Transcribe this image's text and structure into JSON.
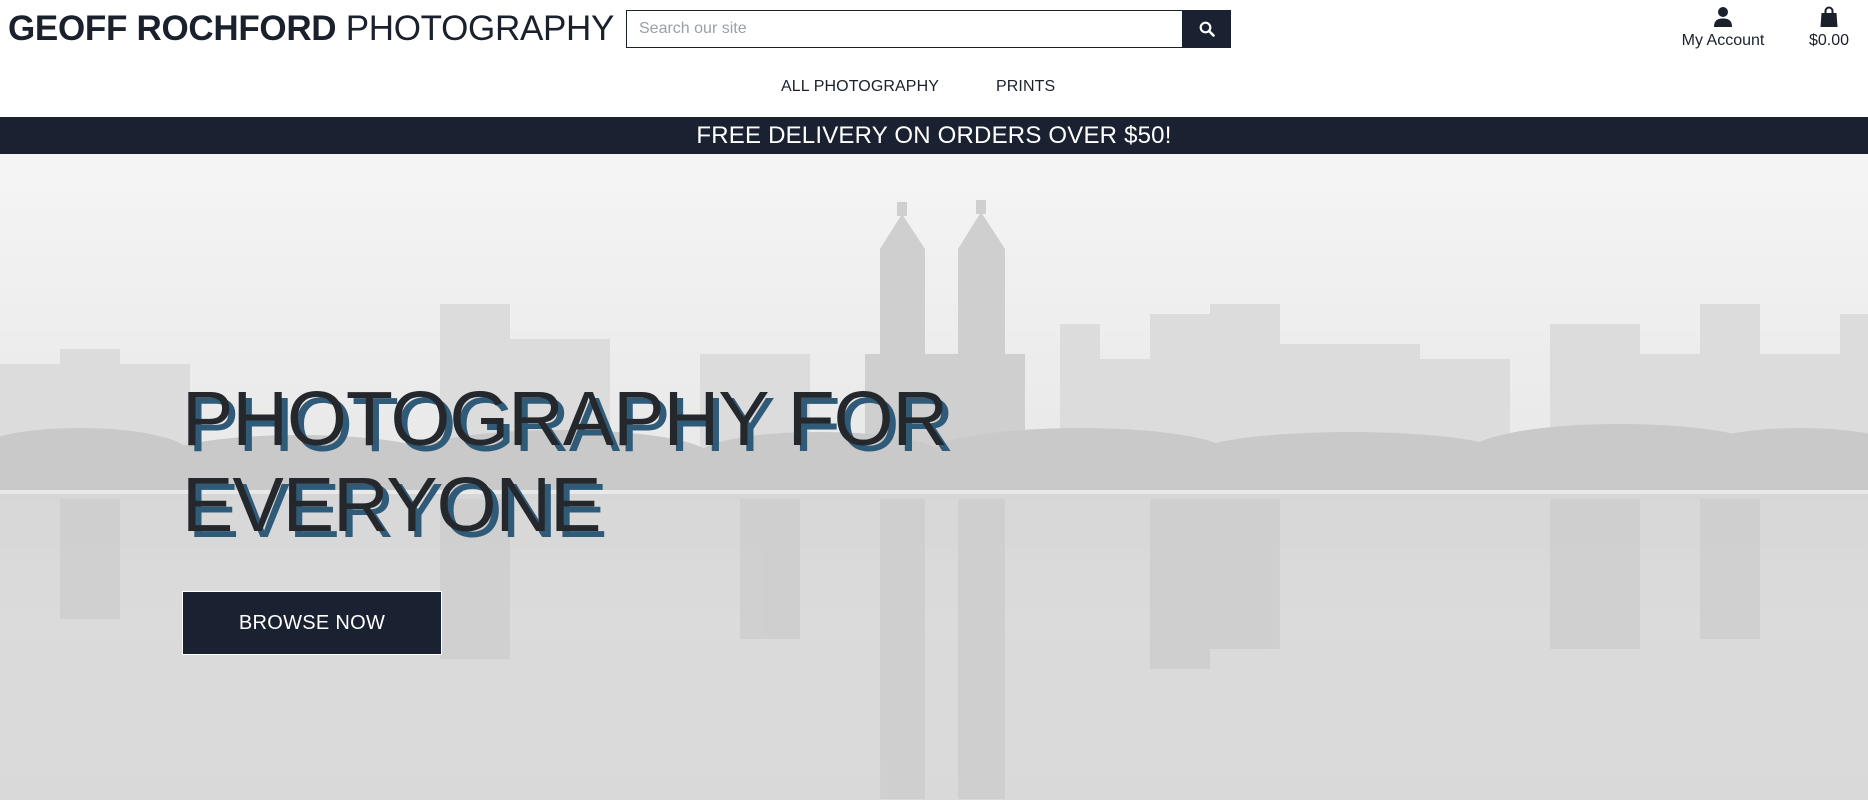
{
  "brand": {
    "bold": "GEOFF ROCHFORD",
    "light": "PHOTOGRAPHY"
  },
  "search": {
    "placeholder": "Search our site",
    "icon": "search-icon"
  },
  "account": {
    "label": "My Account",
    "icon": "user-icon"
  },
  "bag": {
    "total": "$0.00",
    "icon": "shopping-bag-icon"
  },
  "nav": {
    "items": [
      {
        "label": "ALL PHOTOGRAPHY"
      },
      {
        "label": "PRINTS"
      }
    ]
  },
  "banner": {
    "text": "FREE DELIVERY ON ORDERS OVER $50!"
  },
  "hero": {
    "headline_line1": "PHOTOGRAPHY FOR",
    "headline_line2": "EVERYONE",
    "cta_label": "BROWSE NOW"
  },
  "colors": {
    "primary": "#1a2130",
    "headline_shadow": "#2f5b78",
    "text": "#1a202c"
  }
}
